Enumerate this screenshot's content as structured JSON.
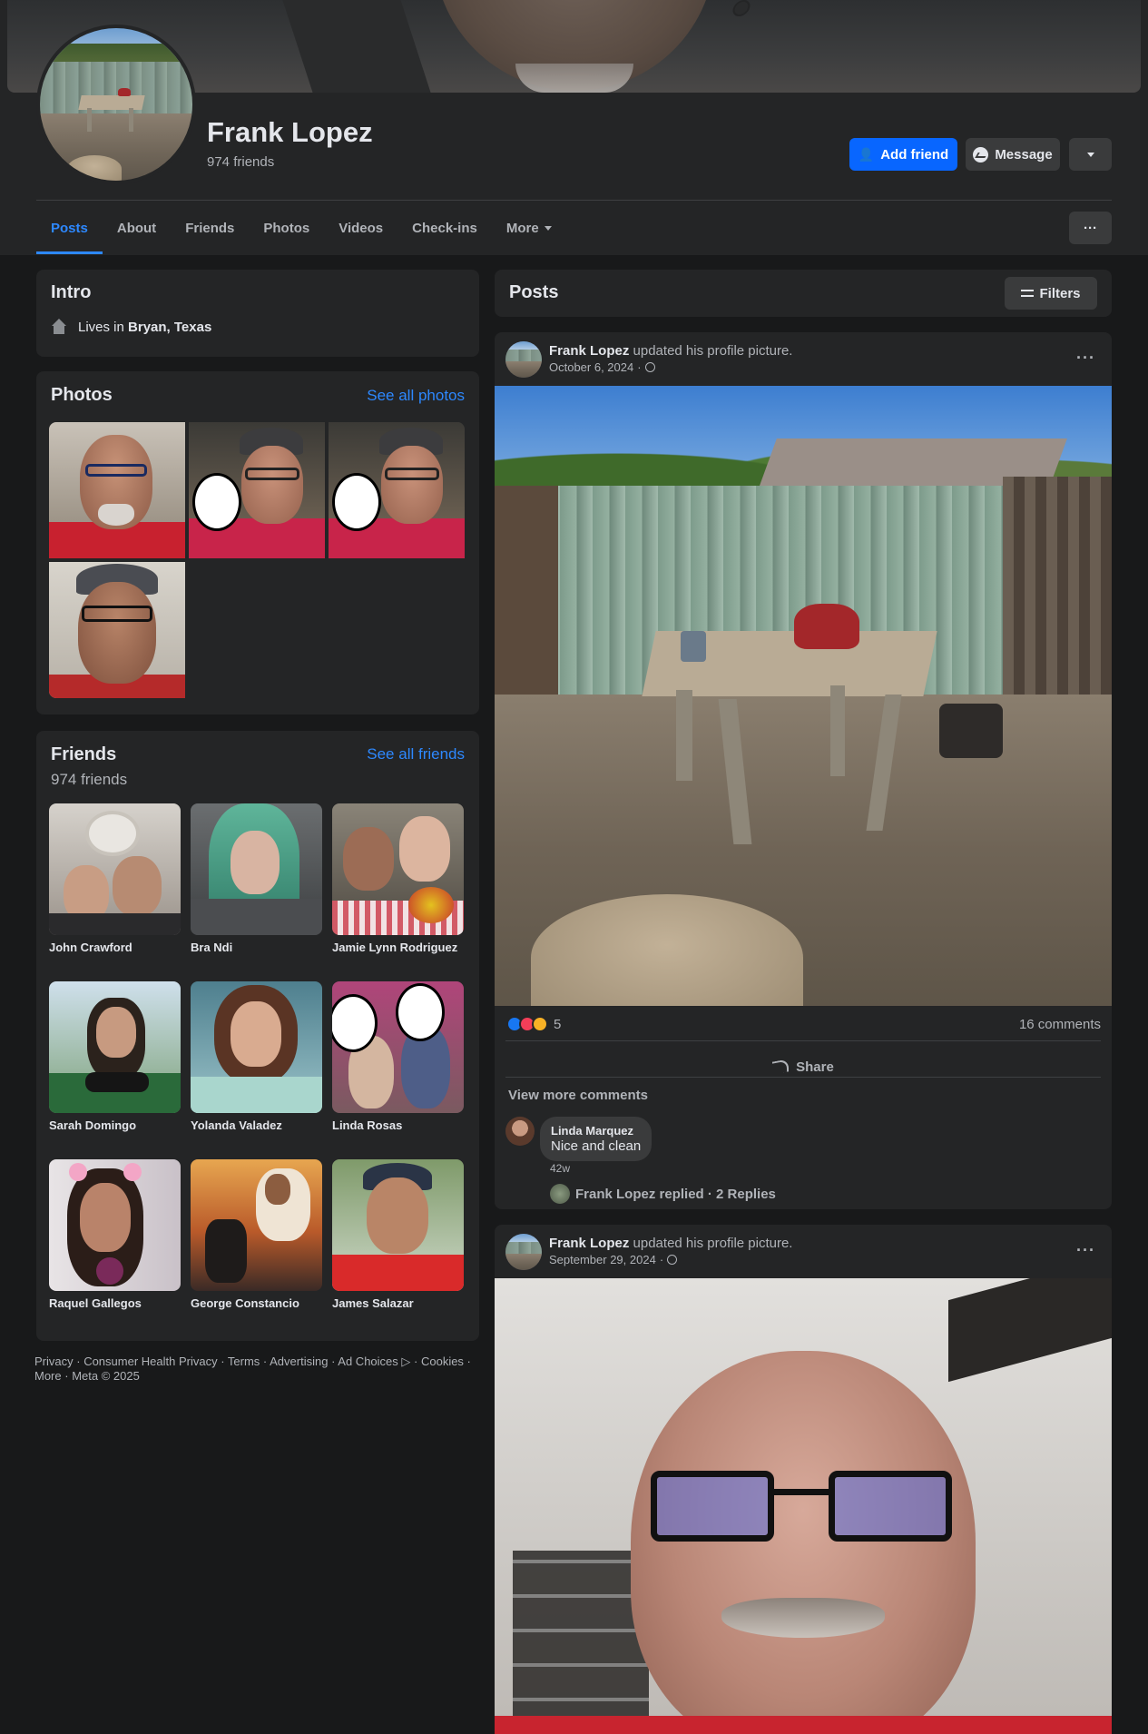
{
  "profile": {
    "name": "Frank Lopez",
    "friends_count": "974 friends",
    "add_friend_label": "Add friend",
    "message_label": "Message"
  },
  "tabs": [
    "Posts",
    "About",
    "Friends",
    "Photos",
    "Videos",
    "Check-ins",
    "More"
  ],
  "active_tab": "Posts",
  "intro": {
    "title": "Intro",
    "lives_prefix": "Lives in ",
    "location": "Bryan, Texas"
  },
  "photos": {
    "title": "Photos",
    "see_all": "See all photos"
  },
  "friends": {
    "title": "Friends",
    "count": "974 friends",
    "see_all": "See all friends",
    "list": [
      "John Crawford",
      "Bra Ndi",
      "Jamie Lynn Rodriguez",
      "Sarah Domingo",
      "Yolanda Valadez",
      "Linda Rosas",
      "Raquel Gallegos",
      "George Constancio",
      "James Salazar"
    ]
  },
  "footer": {
    "links": [
      "Privacy",
      "Consumer Health Privacy",
      "Terms",
      "Advertising",
      "Ad Choices",
      "Cookies",
      "More"
    ],
    "copyright": "Meta © 2025"
  },
  "posts_header": {
    "title": "Posts",
    "filters_label": "Filters"
  },
  "posts": [
    {
      "author": "Frank Lopez",
      "action": " updated his profile picture.",
      "date": "October 6, 2024",
      "reaction_count": "5",
      "comments_count": "16 comments",
      "share_label": "Share",
      "view_more": "View more comments",
      "comment": {
        "author": "Linda Marquez",
        "text": "Nice and clean",
        "time": "42w",
        "replied": "Frank Lopez replied · 2 Replies"
      }
    },
    {
      "author": "Frank Lopez",
      "action": " updated his profile picture.",
      "date": "September 29, 2024"
    }
  ],
  "colors": {
    "page_bg": "#18191a",
    "card_bg": "#242526",
    "accent": "#2d88ff",
    "add_friend_bg": "#0866ff"
  },
  "icons": [
    "add-person-icon",
    "messenger-icon",
    "chevron-down-icon",
    "more-dots-icon",
    "home-icon",
    "filter-icon",
    "globe-icon",
    "share-icon",
    "like-reaction-icon",
    "love-reaction-icon",
    "care-reaction-icon"
  ]
}
